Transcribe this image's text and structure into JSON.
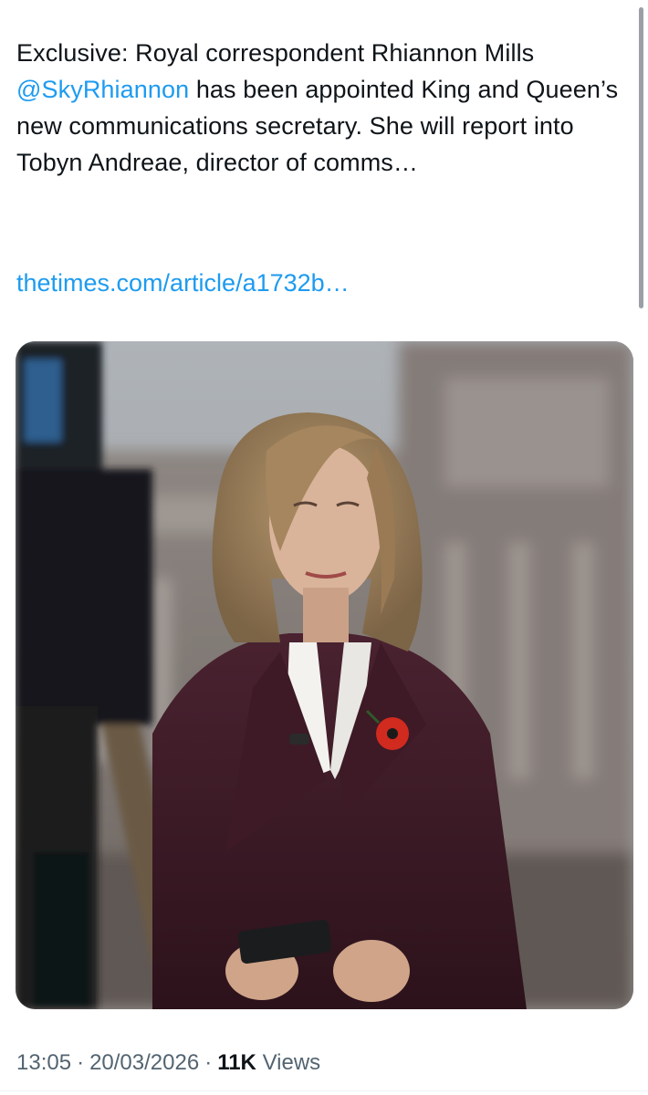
{
  "tweet": {
    "text_prefix": "Exclusive: Royal correspondent Rhiannon Mills ",
    "mention": "@SkyRhiannon",
    "text_suffix": " has been appointed King and Queen’s new communications secretary. She will report into Tobyn Andreae, director of comms…",
    "link": "thetimes.com/article/a1732b…",
    "time": "13:05",
    "date": "20/03/2026",
    "views_count": "11K",
    "views_label": "Views"
  },
  "colors": {
    "text": "#0f1419",
    "link": "#1d9bf0",
    "meta": "#536471"
  }
}
